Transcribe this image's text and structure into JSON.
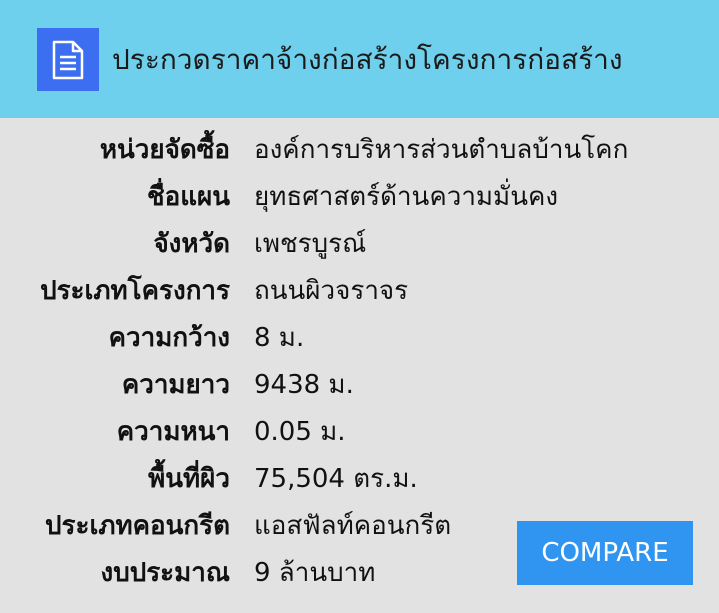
{
  "header": {
    "icon": "document-icon",
    "title": "ประกวดราคาจ้างก่อสร้างโครงการก่อสร้าง"
  },
  "details": [
    {
      "key": "agency",
      "label": "หน่วยจัดซื้อ",
      "value": "องค์การบริหารส่วนตำบลบ้านโคก"
    },
    {
      "key": "plan",
      "label": "ชื่อแผน",
      "value": "ยุทธศาสตร์ด้านความมั่นคง"
    },
    {
      "key": "province",
      "label": "จังหวัด",
      "value": "เพชรบูรณ์"
    },
    {
      "key": "project_type",
      "label": "ประเภทโครงการ",
      "value": "ถนนผิวจราจร"
    },
    {
      "key": "width",
      "label": "ความกว้าง",
      "value": "8 ม."
    },
    {
      "key": "length",
      "label": "ความยาว",
      "value": "9438 ม."
    },
    {
      "key": "thickness",
      "label": "ความหนา",
      "value": "0.05 ม."
    },
    {
      "key": "area",
      "label": "พื้นที่ผิว",
      "value": "75,504 ตร.ม."
    },
    {
      "key": "concrete_type",
      "label": "ประเภทคอนกรีต",
      "value": "แอสฟัลท์คอนกรีต"
    },
    {
      "key": "budget",
      "label": "งบประมาณ",
      "value": "9 ล้านบาท"
    }
  ],
  "compare_button": {
    "label": "COMPARE"
  },
  "colors": {
    "header_bg": "#6fd0ee",
    "icon_bg": "#3c6ef1",
    "page_bg": "#e2e2e2",
    "button_bg": "#2f95f0"
  }
}
